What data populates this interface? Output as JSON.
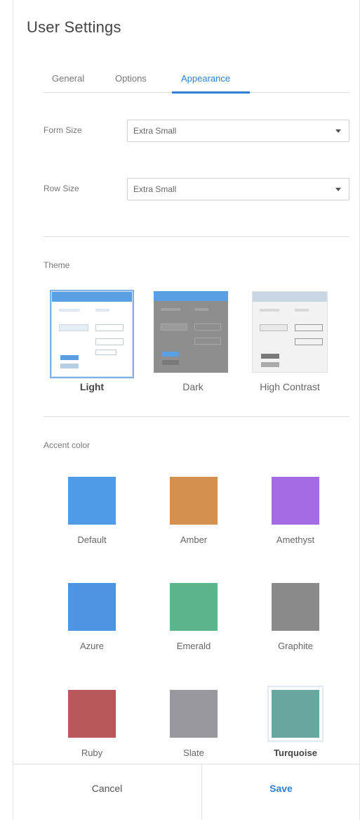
{
  "title": "User Settings",
  "tabs": [
    {
      "label": "General"
    },
    {
      "label": "Options"
    },
    {
      "label": "Appearance"
    }
  ],
  "active_tab": "Appearance",
  "form_size": {
    "label": "Form Size",
    "value": "Extra Small"
  },
  "row_size": {
    "label": "Row Size",
    "value": "Extra Small"
  },
  "theme": {
    "label": "Theme",
    "selected": "Light",
    "options": [
      {
        "label": "Light"
      },
      {
        "label": "Dark"
      },
      {
        "label": "High Contrast"
      }
    ]
  },
  "accent": {
    "label": "Accent color",
    "selected": "Turquoise",
    "options": [
      {
        "label": "Default",
        "color": "#4f9be8"
      },
      {
        "label": "Amber",
        "color": "#d4904f"
      },
      {
        "label": "Amethyst",
        "color": "#a56be4"
      },
      {
        "label": "Azure",
        "color": "#4f94e2"
      },
      {
        "label": "Emerald",
        "color": "#5cb58a"
      },
      {
        "label": "Graphite",
        "color": "#8a8a8a"
      },
      {
        "label": "Ruby",
        "color": "#b8585a"
      },
      {
        "label": "Slate",
        "color": "#98989e"
      },
      {
        "label": "Turquoise",
        "color": "#6aa6a0"
      }
    ]
  },
  "footer": {
    "cancel": "Cancel",
    "save": "Save"
  },
  "colors": {
    "accent_blue": "#2d80d6"
  }
}
